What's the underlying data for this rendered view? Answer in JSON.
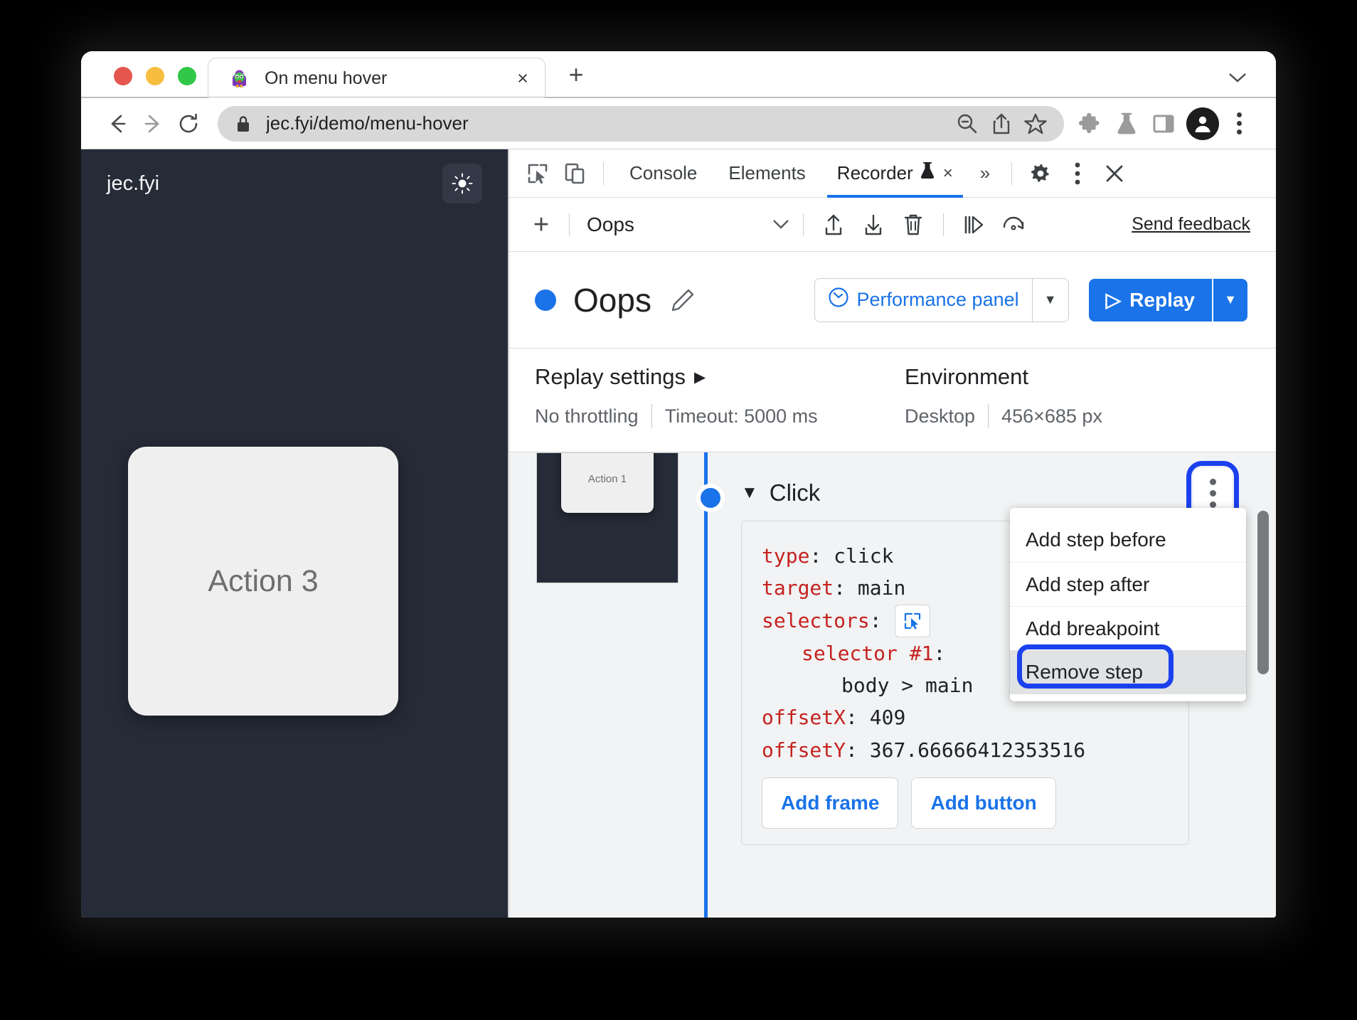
{
  "browser": {
    "tab": {
      "title": "On menu hover",
      "favicon_name": "puffin-favicon",
      "close_label": "×"
    },
    "new_tab_label": "+",
    "tabstrip_chevron": "⌄",
    "nav": {
      "back_icon": "back-arrow-icon",
      "forward_icon": "forward-arrow-icon",
      "reload_icon": "reload-icon"
    },
    "url": "jec.fyi/demo/menu-hover",
    "omnibox_icons": [
      "zoom-out-icon",
      "share-icon",
      "bookmark-star-icon"
    ],
    "toolbar_icons": [
      "extensions-puzzle-icon",
      "experiments-flask-icon",
      "side-panel-icon"
    ],
    "profile_icon": "profile-avatar-icon",
    "menu_icon": "browser-menu-icon"
  },
  "page": {
    "site_name": "jec.fyi",
    "theme_toggle_icon": "sun-icon",
    "action_button_label": "Action 3"
  },
  "devtools": {
    "tabs": [
      {
        "label": "Console",
        "active": false
      },
      {
        "label": "Elements",
        "active": false
      },
      {
        "label": "Recorder",
        "active": true,
        "experimental_icon": "flask-icon",
        "close_label": "×"
      }
    ],
    "overflow_label": "»",
    "settings_icon": "gear-icon",
    "more_icon": "more-vertical-icon",
    "close_icon": "close-icon",
    "inspect_icon": "inspect-element-icon",
    "device_icon": "device-toolbar-icon"
  },
  "recorder_toolbar": {
    "add_label": "+",
    "recording_name": "Oops",
    "chevron": "⌄",
    "icons": [
      "export-icon",
      "import-icon",
      "delete-trash-icon",
      "step-over-icon",
      "replay-again-icon"
    ],
    "send_feedback": "Send feedback"
  },
  "recording": {
    "title": "Oops",
    "edit_icon": "pencil-icon",
    "perf_panel_label": "Performance panel",
    "perf_panel_icon": "performance-gauge-icon",
    "perf_dropdown_arrow": "▼",
    "replay_label": "Replay",
    "replay_icon": "▷",
    "replay_dropdown_arrow": "▼"
  },
  "settings": {
    "replay_title": "Replay settings",
    "replay_caret": "▶",
    "throttling": "No throttling",
    "timeout": "Timeout: 5000 ms",
    "environment_title": "Environment",
    "device": "Desktop",
    "viewport": "456×685 px"
  },
  "step": {
    "thumbnail_label": "Action 1",
    "caret": "▼",
    "title": "Click",
    "menu_icon": "step-more-vertical-icon",
    "fields": {
      "type_key": "type",
      "type_value": "click",
      "target_key": "target",
      "target_value": "main",
      "selectors_key": "selectors",
      "selector_pick_icon": "selector-picker-icon",
      "selector1_key": "selector #1",
      "selector1_value": "body > main",
      "offsetx_key": "offsetX",
      "offsetx_value": "409",
      "offsety_key": "offsetY",
      "offsety_value": "367.66666412353516"
    },
    "add_frame_label": "Add frame",
    "add_button_label": "Add button"
  },
  "context_menu": {
    "items": [
      {
        "label": "Add step before",
        "hovered": false
      },
      {
        "label": "Add step after",
        "hovered": false
      },
      {
        "label": "Add breakpoint",
        "hovered": false
      },
      {
        "label": "Remove step",
        "hovered": true
      }
    ]
  },
  "colors": {
    "accent_blue": "#1a73e8",
    "highlight_blue": "#1b41ef",
    "code_key_red": "#c5221f",
    "page_dark": "#262b38",
    "devtools_bg": "#f1f3f4"
  }
}
